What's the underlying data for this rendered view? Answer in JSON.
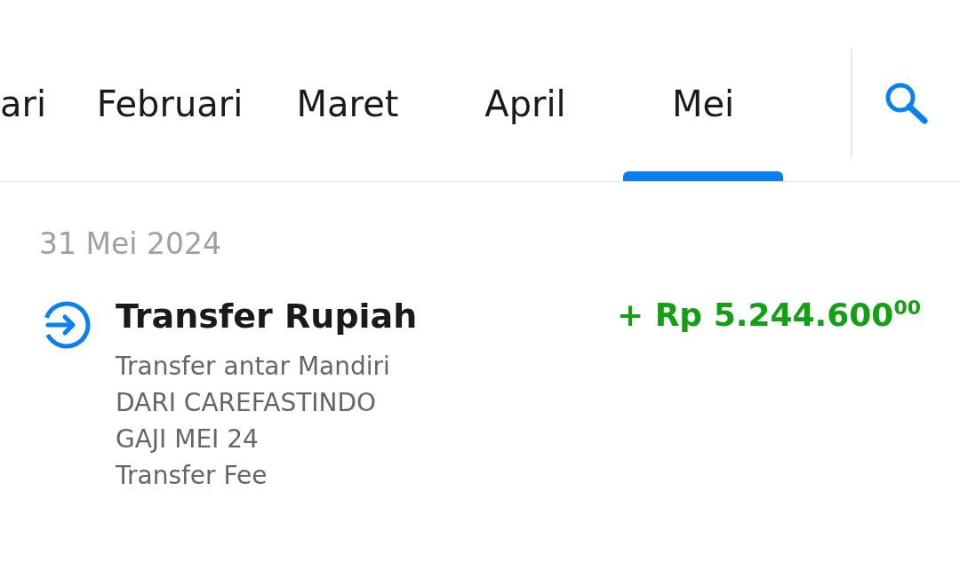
{
  "tabs": [
    {
      "label": "ari",
      "selected": false
    },
    {
      "label": "Februari",
      "selected": false
    },
    {
      "label": "Maret",
      "selected": false
    },
    {
      "label": "April",
      "selected": false
    },
    {
      "label": "Mei",
      "selected": true
    }
  ],
  "date_header": "31 Mei 2024",
  "transactions": [
    {
      "title": "Transfer Rupiah",
      "amount": "+ Rp 5.244.600$^{00}$",
      "details": [
        "Transfer antar Mandiri",
        "DARI CAREFASTINDO",
        "GAJI MEI 24",
        "Transfer Fee"
      ]
    }
  ]
}
